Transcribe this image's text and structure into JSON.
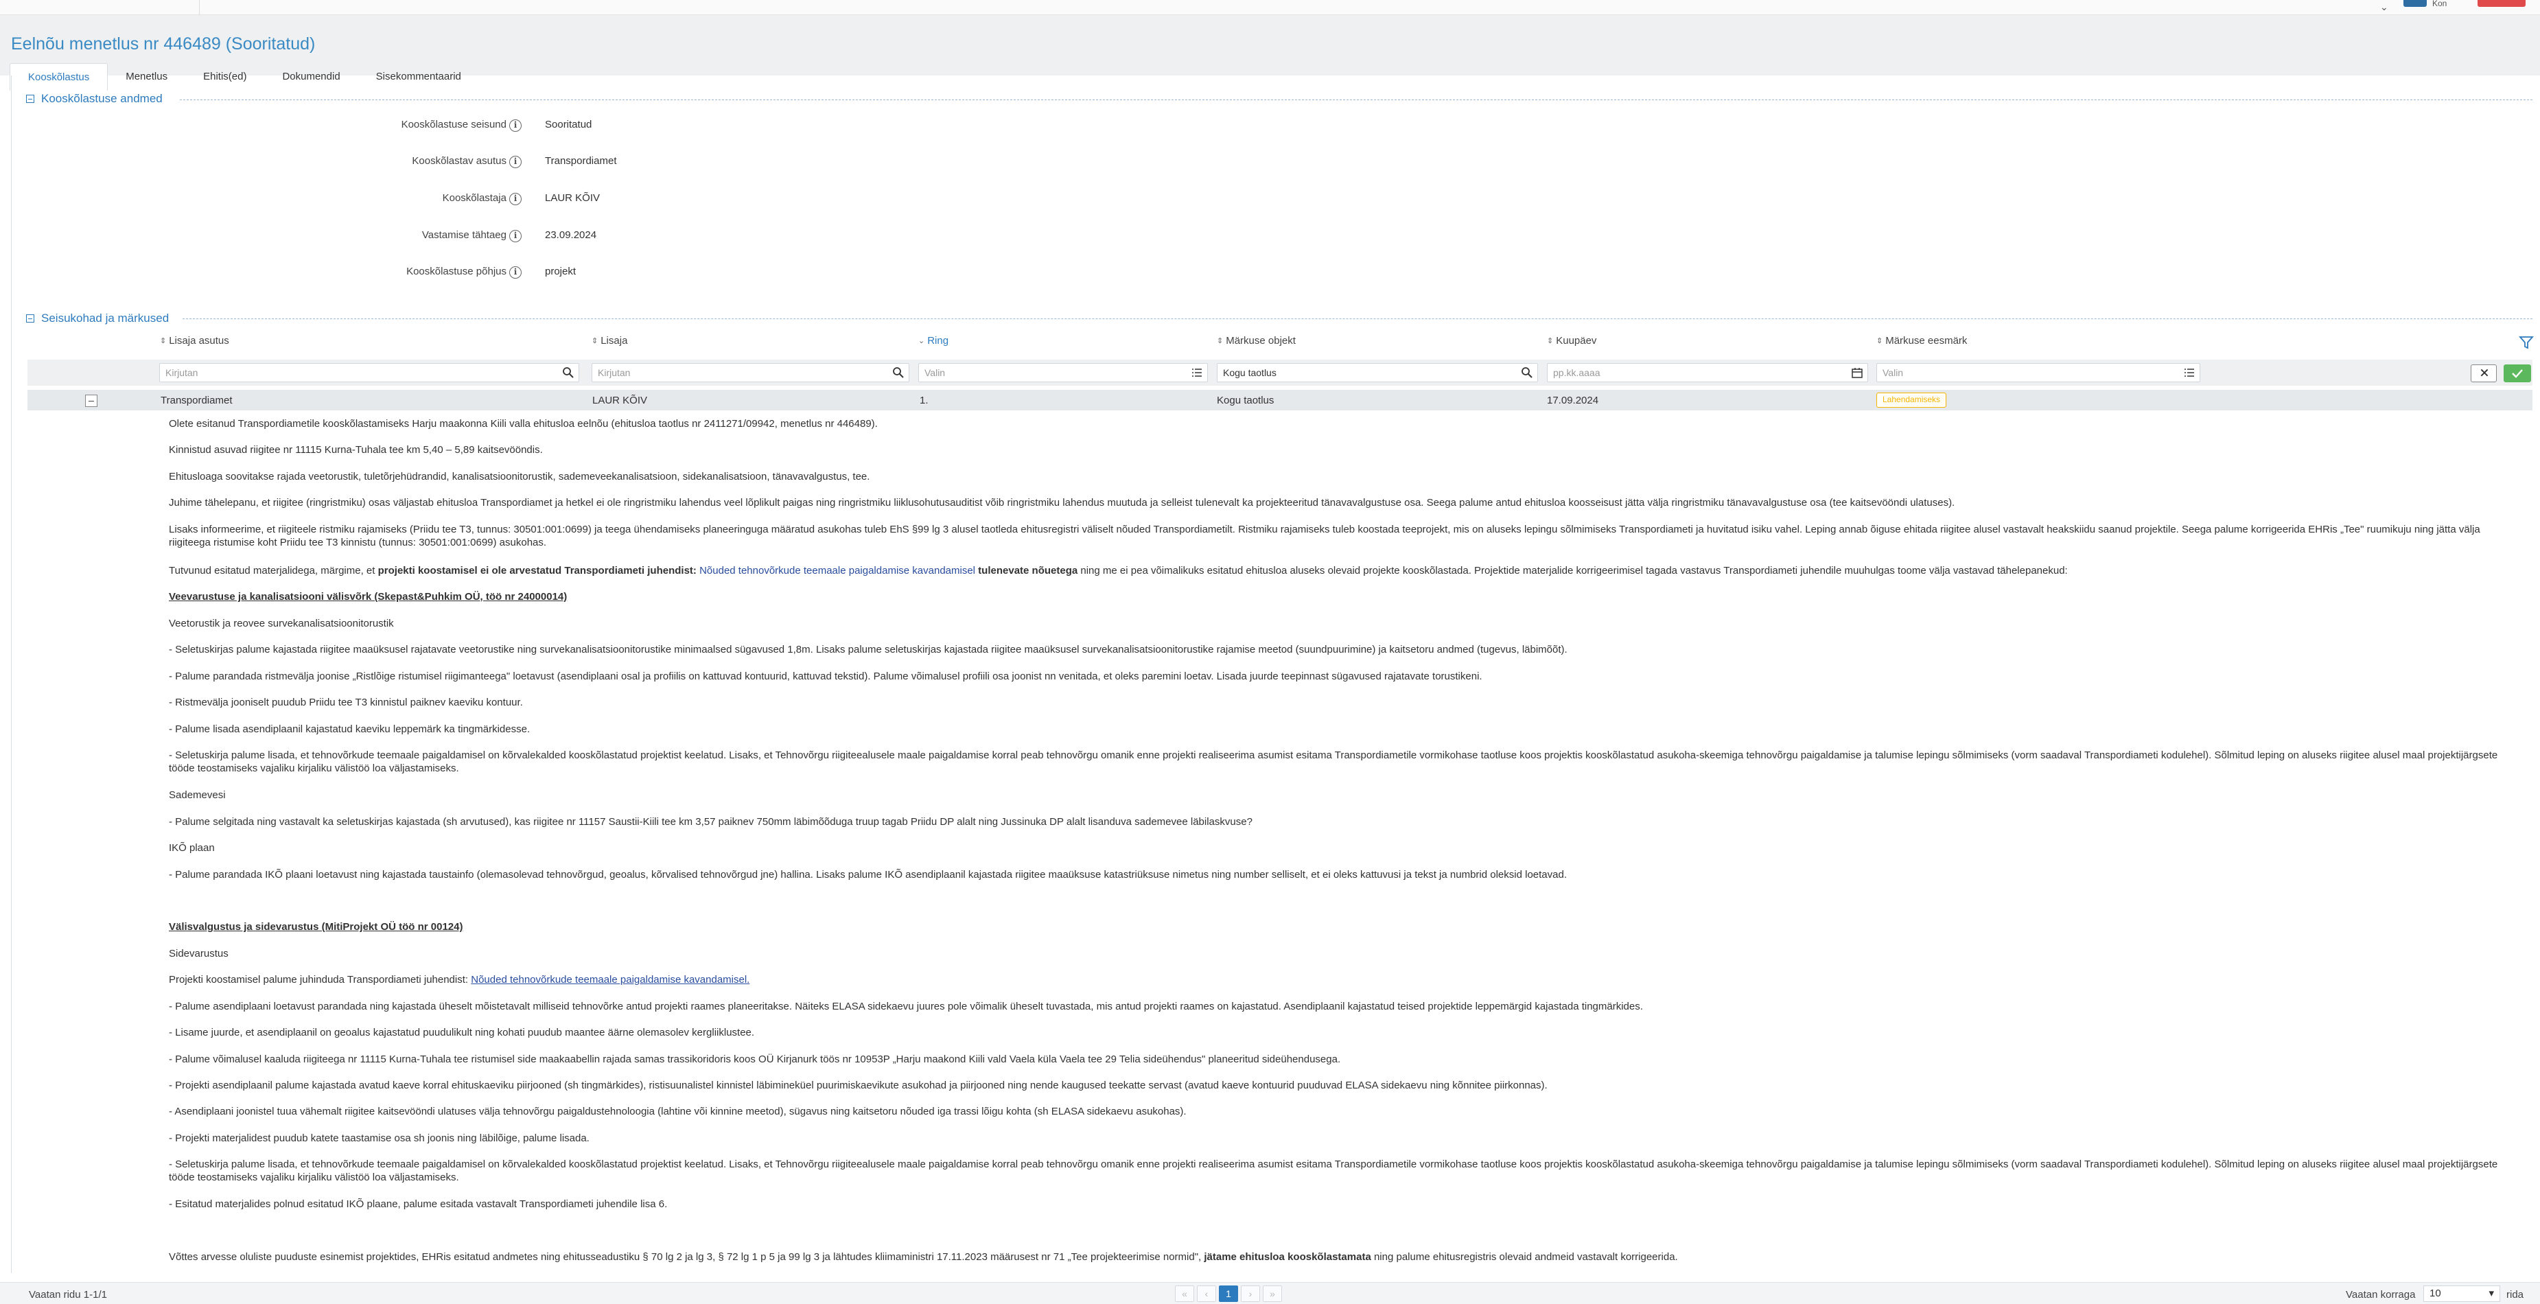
{
  "topbar": {
    "lang": "⌄",
    "lang_text": "Kon"
  },
  "page": {
    "title": "Eelnõu menetlus nr 446489 (Sooritatud)"
  },
  "tabs": [
    {
      "label": "Kooskõlastus"
    },
    {
      "label": "Menetlus"
    },
    {
      "label": "Ehitis(ed)"
    },
    {
      "label": "Dokumendid"
    },
    {
      "label": "Sisekommentaarid"
    }
  ],
  "section1": {
    "title": "Kooskõlastuse andmed",
    "fields": [
      {
        "label": "Kooskõlastuse seisund",
        "value": "Sooritatud"
      },
      {
        "label": "Kooskõlastav asutus",
        "value": "Transpordiamet"
      },
      {
        "label": "Kooskõlastaja",
        "value": "LAUR KÕIV"
      },
      {
        "label": "Vastamise tähtaeg",
        "value": "23.09.2024"
      },
      {
        "label": "Kooskõlastuse põhjus",
        "value": "projekt"
      }
    ]
  },
  "section2": {
    "title": "Seisukohad ja märkused"
  },
  "table": {
    "columns": [
      {
        "label": "Lisaja asutus"
      },
      {
        "label": "Lisaja"
      },
      {
        "label": "Ring"
      },
      {
        "label": "Märkuse objekt"
      },
      {
        "label": "Kuupäev"
      },
      {
        "label": "Märkuse eesmärk"
      }
    ],
    "filters": [
      {
        "placeholder": "Kirjutan",
        "value": ""
      },
      {
        "placeholder": "Kirjutan",
        "value": ""
      },
      {
        "placeholder": "Valin",
        "value": ""
      },
      {
        "placeholder": "",
        "value": "Kogu taotlus"
      },
      {
        "placeholder": "pp.kk.aaaa",
        "value": ""
      },
      {
        "placeholder": "Valin",
        "value": ""
      }
    ],
    "row": {
      "asutus": "Transpordiamet",
      "lisaja": "LAUR KÕIV",
      "ring": "1.",
      "objekt": "Kogu taotlus",
      "kuupaev": "17.09.2024",
      "eesmark": "Lahendamiseks"
    }
  },
  "comment": {
    "p1": "Olete esitanud Transpordiametile kooskõlastamiseks Harju maakonna Kiili valla ehitusloa eelnõu (ehitusloa taotlus nr 2411271/09942, menetlus nr 446489).",
    "p2": "Kinnistud asuvad riigitee nr 11115 Kurna-Tuhala tee km 5,40 – 5,89 kaitsevööndis.",
    "p3": "Ehitusloaga soovitakse rajada veetorustik, tuletõrjehüdrandid, kanalisatsioonitorustik, sademeveekanalisatsioon, sidekanalisatsioon, tänavavalgustus, tee.",
    "p4": "Juhime tähelepanu, et riigitee (ringristmiku) osas väljastab ehitusloa Transpordiamet ja hetkel ei ole ringristmiku lahendus veel lõplikult paigas ning ringristmiku liiklusohutusauditist võib ringristmiku lahendus muutuda ja selleist tulenevalt ka projekteeritud tänavavalgustuse osa. Seega palume antud ehitusloa koosseisust jätta välja ringristmiku tänavavalgustuse osa (tee kaitsevööndi ulatuses).",
    "p5": "Lisaks informeerime, et riigiteele ristmiku rajamiseks (Priidu tee T3, tunnus: 30501:001:0699) ja teega ühendamiseks planeeringuga määratud asukohas tuleb EhS §99 lg 3 alusel taotleda ehitusregistri väliselt nõuded Transpordiametilt. Ristmiku rajamiseks tuleb koostada teeprojekt, mis on aluseks lepingu sõlmimiseks Transpordiameti ja huvitatud isiku vahel. Leping annab õiguse ehitada riigitee alusel vastavalt heakskiidu saanud projektile. Seega palume korrigeerida EHRis „Tee\" ruumikuju ning jätta välja riigiteega ristumise koht Priidu tee T3 kinnistu (tunnus: 30501:001:0699) asukohas.",
    "p6a": "Tutvunud esitatud materjalidega, märgime, et ",
    "p6b": "projekti koostamisel ei ole arvestatud Transpordiameti juhendist: ",
    "p6c": "Nõuded tehnovõrkude teemaale paigaldamise kavandamisel",
    "p6d": " tulenevate nõuetega",
    "p6e": " ning me ei pea võimalikuks esitatud ehitusloa aluseks olevaid projekte kooskõlastada. Projektide materjalide korrigeerimisel tagada vastavus Transpordiameti juhendile muuhulgas toome välja vastavad tähelepanekud:",
    "h1": "Veevarustuse ja kanalisatsiooni välisvõrk (Skepast&Puhkim OÜ, töö nr 24000014)",
    "s1": "Veetorustik ja reovee survekanalisatsioonitorustik",
    "b1": "- Seletuskirjas palume kajastada riigitee maaüksusel rajatavate veetorustike ning survekanalisatsioonitorustike minimaalsed sügavused 1,8m. Lisaks palume seletuskirjas kajastada riigitee maaüksusel survekanalisatsioonitorustike rajamise meetod (suundpuurimine) ja kaitsetoru andmed (tugevus, läbimõõt).",
    "b2": "- Palume parandada ristmevälja joonise „Ristlõige ristumisel riigimanteega\" loetavust (asendiplaani osal ja  profiilis on kattuvad kontuurid, kattuvad tekstid). Palume võimalusel profiili osa joonist nn venitada, et oleks paremini loetav. Lisada juurde teepinnast sügavused rajatavate torustikeni.",
    "b3": "- Ristmevälja jooniselt puudub Priidu tee T3 kinnistul paiknev kaeviku kontuur.",
    "b4": "- Palume lisada asendiplaanil kajastatud kaeviku leppemärk ka tingmärkidesse.",
    "b5": "- Seletuskirja palume lisada, et tehnovõrkude teemaale paigaldamisel on kõrvalekalded kooskõlastatud projektist keelatud. Lisaks, et Tehnovõrgu riigiteealusele maale paigaldamise korral peab tehnovõrgu omanik enne projekti realiseerima asumist esitama Transpordiametile vormikohase taotluse koos projektis kooskõlastatud asukoha-skeemiga tehnovõrgu paigaldamise ja talumise lepingu sõlmimiseks (vorm saadaval Transpordiameti kodulehel). Sõlmitud leping on aluseks riigitee alusel maal projektijärgsete tööde teostamiseks vajaliku kirjaliku välistöö loa väljastamiseks.",
    "s2": "Sademevesi",
    "b6": "- Palume selgitada ning vastavalt ka seletuskirjas kajastada (sh arvutused), kas riigitee nr 11157 Saustii-Kiili tee km 3,57 paiknev 750mm läbimõõduga truup tagab Priidu DP alalt ning Jussinuka DP alalt lisanduva sademevee läbilaskvuse?",
    "s3": "IKÕ plaan",
    "b7": "-  Palume parandada IKÕ plaani loetavust ning kajastada taustainfo (olemasolevad tehnovõrgud, geoalus, kõrvalised tehnovõrgud jne) hallina. Lisaks palume IKÕ asendiplaanil kajastada riigitee maaüksuse katastriüksuse nimetus ning number selliselt, et ei oleks kattuvusi ja tekst ja numbrid oleksid loetavad.",
    "h2": "Välisvalgustus ja sidevarustus (MitiProjekt OÜ töö nr 00124)",
    "s4": "Sidevarustus",
    "p7a": "Projekti koostamisel palume juhinduda Transpordiameti juhendist: ",
    "p7b": "Nõuded tehnovõrkude teemaale paigaldamise kavandamisel.",
    "c1": "-  Palume asendiplaani loetavust parandada ning kajastada üheselt mõistetavalt milliseid tehnovõrke antud projekti raames planeeritakse. Näiteks ELASA sidekaevu juures pole võimalik üheselt tuvastada, mis antud projekti raames on kajastatud. Asendiplaanil kajastatud teised projektide leppemärgid kajastada tingmärkides.",
    "c2": "-  Lisame juurde, et asendiplaanil on geoalus kajastatud puudulikult ning kohati puudub maantee äärne olemasolev kergliiklustee.",
    "c3": "-  Palume võimalusel kaaluda riigiteega nr 11115 Kurna-Tuhala tee ristumisel side maakaabellin rajada samas trassikoridoris koos OÜ Kirjanurk töös nr 10953P „Harju maakond Kiili vald Vaela küla Vaela tee 29 Telia sideühendus\" planeeritud sideühendusega.",
    "c4": "-  Projekti asendiplaanil palume kajastada avatud kaeve korral ehituskaeviku piirjooned (sh tingmärkides), ristisuunalistel kinnistel läbimineküel puurimiskaevikute asukohad ja piirjooned ning nende kaugused teekatte servast (avatud kaeve kontuurid puuduvad ELASA sidekaevu ning kõnnitee piirkonnas).",
    "c5": "-  Asendiplaani joonistel tuua vähemalt riigitee kaitsevööndi ulatuses välja tehnovõrgu paigaldustehnoloogia (lahtine või kinnine meetod), sügavus ning kaitsetoru nõuded iga trassi lõigu kohta (sh ELASA sidekaevu asukohas).",
    "c6": "-  Projekti materjalidest puudub katete taastamise osa sh joonis ning läbilõige, palume lisada.",
    "c7": "-  Seletuskirja palume lisada, et tehnovõrkude teemaale paigaldamisel on kõrvalekalded kooskõlastatud projektist keelatud. Lisaks, et Tehnovõrgu riigiteealusele maale paigaldamise korral peab tehnovõrgu omanik enne projekti realiseerima asumist esitama Transpordiametile vormikohase taotluse koos projektis kooskõlastatud asukoha-skeemiga tehnovõrgu paigaldamise ja talumise lepingu sõlmimiseks (vorm saadaval Transpordiameti kodulehel). Sõlmitud leping on aluseks riigitee alusel maal projektijärgsete tööde teostamiseks vajaliku kirjaliku välistöö loa väljastamiseks.",
    "c8": "-  Esitatud materjalides polnud esitatud IKÕ plaane, palume esitada vastavalt Transpordiameti juhendile lisa 6.",
    "f1a": "Võttes arvesse oluliste puuduste esinemist projektides, EHRis esitatud andmetes ning ehitusseadustiku § 70 lg 2 ja lg 3, § 72 lg 1 p 5 ja 99 lg 3 ja lähtudes kliimaministri 17.11.2023 määrusest nr 71 „Tee projekteerimise normid\", ",
    "f1b": "jätame ehitusloa kooskõlastamata",
    "f1c": " ning palume ehitusregistris olevaid andmeid vastavalt korrigeerida."
  },
  "footer": {
    "info": "Vaatan ridu 1-1/1",
    "pager": {
      "first": "«",
      "prev": "‹",
      "current": "1",
      "next": "›",
      "last": "»"
    },
    "perpage_label": "Vaatan korraga",
    "perpage_value": "10",
    "rida": "rida"
  },
  "colors": {
    "accent": "#2d7bbf",
    "badge": "#f5b400",
    "ok": "#5cb85c"
  }
}
